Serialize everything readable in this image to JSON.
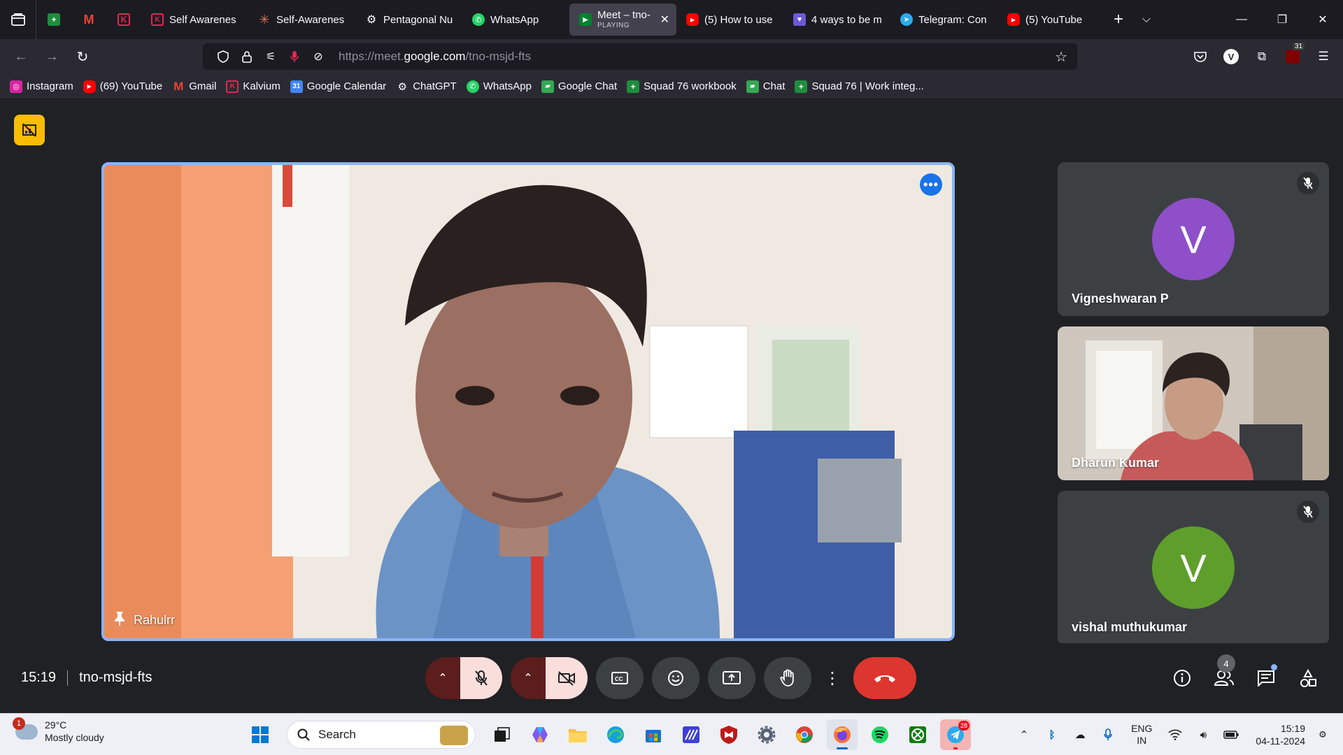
{
  "browser": {
    "tabs": [
      {
        "title": "Self Awarenes",
        "icon": "kalvium-icon"
      },
      {
        "title": "Self-Awarenes",
        "icon": "claude-icon"
      },
      {
        "title": "Pentagonal Nu",
        "icon": "chatgpt-icon"
      },
      {
        "title": "WhatsApp",
        "icon": "whatsapp-icon"
      },
      {
        "title": "Meet – tno-",
        "subtitle": "PLAYING",
        "icon": "meet-icon",
        "active": true
      },
      {
        "title": "(5) How to use",
        "icon": "youtube-icon"
      },
      {
        "title": "4 ways to be m",
        "icon": "heart-icon"
      },
      {
        "title": "Telegram: Con",
        "icon": "telegram-icon"
      },
      {
        "title": "(5) YouTube",
        "icon": "youtube-icon"
      }
    ],
    "url_prefix": "https://meet.",
    "url_domain": "google.com",
    "url_path": "/tno-msjd-fts",
    "ublock_count": "31",
    "profile_initial": "V",
    "bookmarks": [
      {
        "label": "Instagram",
        "icon": "instagram-icon"
      },
      {
        "label": "(69) YouTube",
        "icon": "youtube-icon"
      },
      {
        "label": "Gmail",
        "icon": "gmail-icon"
      },
      {
        "label": "Kalvium",
        "icon": "kalvium-icon"
      },
      {
        "label": "Google Calendar",
        "icon": "calendar-icon"
      },
      {
        "label": "ChatGPT",
        "icon": "chatgpt-icon"
      },
      {
        "label": "WhatsApp",
        "icon": "whatsapp-icon"
      },
      {
        "label": "Google Chat",
        "icon": "chat-icon"
      },
      {
        "label": "Squad 76 workbook",
        "icon": "sheets-icon"
      },
      {
        "label": "Chat",
        "icon": "chat-icon"
      },
      {
        "label": "Squad 76 | Work integ...",
        "icon": "sheets-icon"
      }
    ]
  },
  "meet": {
    "main_participant": "Rahulrr",
    "participants": [
      {
        "name": "Vigneshwaran P",
        "initial": "V",
        "avatar_color": "#8e4fc9",
        "muted": true
      },
      {
        "name": "Dharun Kumar",
        "video": true,
        "muted": false
      },
      {
        "name": "vishal muthukumar",
        "initial": "V",
        "avatar_color": "#5e9e2b",
        "muted": true
      }
    ],
    "time": "15:19",
    "meeting_code": "tno-msjd-fts",
    "people_count": "4"
  },
  "taskbar": {
    "weather_temp": "29°C",
    "weather_desc": "Mostly cloudy",
    "weather_badge": "1",
    "search_placeholder": "Search",
    "telegram_badge": "28",
    "lang_top": "ENG",
    "lang_bottom": "IN",
    "clock_time": "15:19",
    "clock_date": "04-11-2024"
  },
  "colors": {
    "accent": "#8ab4f8",
    "end_call": "#dc362e",
    "muted_control": "#f9dedc"
  }
}
